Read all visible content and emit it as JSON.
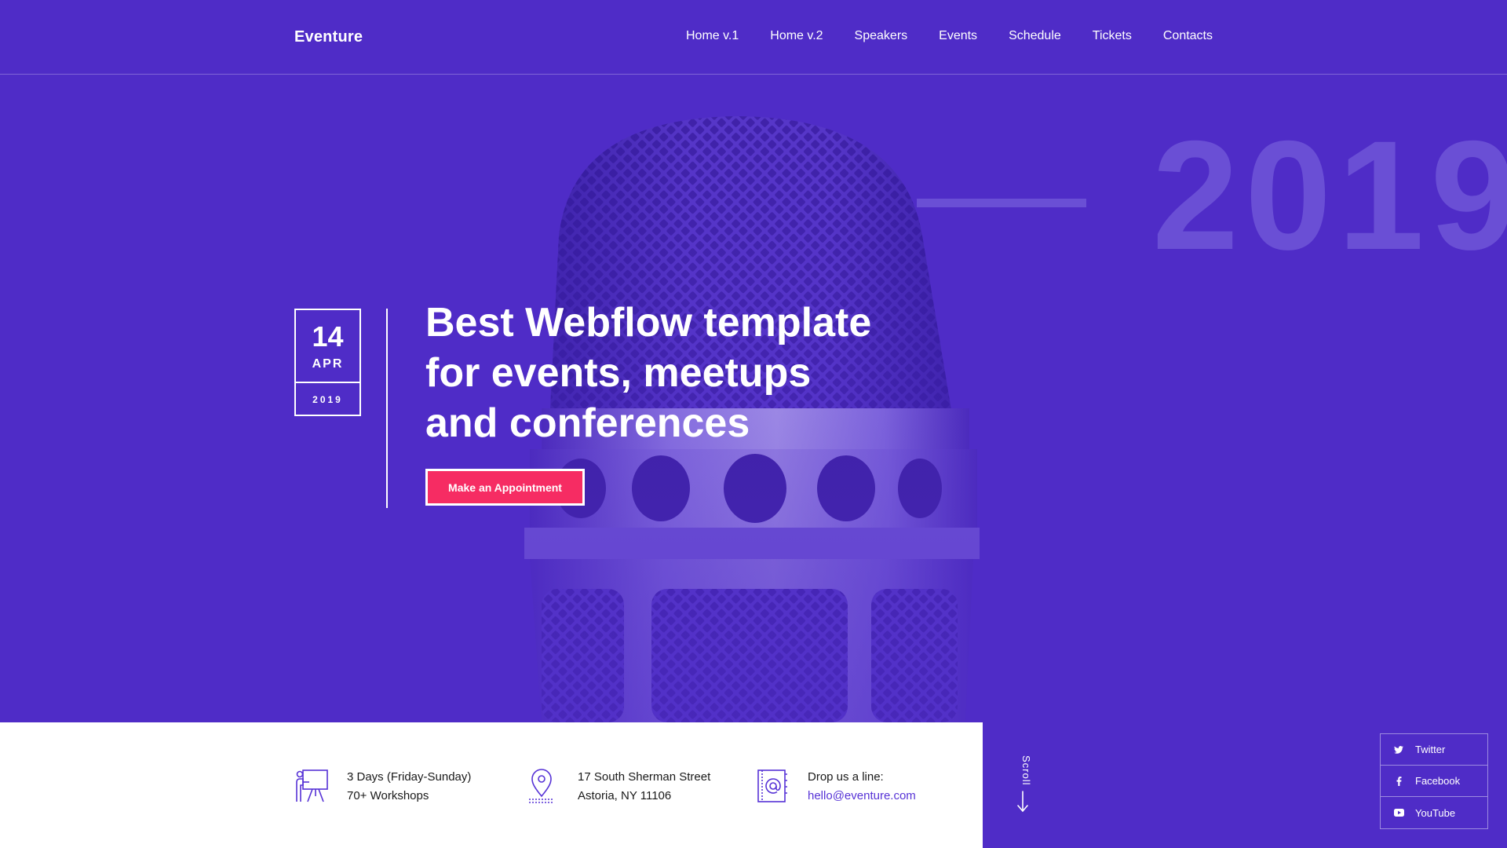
{
  "brand": {
    "name": "Eventure"
  },
  "nav": {
    "items": [
      "Home v.1",
      "Home v.2",
      "Speakers",
      "Events",
      "Schedule",
      "Tickets",
      "Contacts"
    ]
  },
  "hero": {
    "year_watermark": "2019",
    "date": {
      "day": "14",
      "month": "APR",
      "year": "2019"
    },
    "headline_lines": [
      "Best Webflow template",
      "for events, meetups",
      "and conferences"
    ],
    "cta_label": "Make an Appointment"
  },
  "info": {
    "duration": {
      "line1": "3 Days (Friday-Sunday)",
      "line2": "70+ Workshops",
      "icon": "presentation-icon"
    },
    "location": {
      "line1": "17 South Sherman Street",
      "line2": "Astoria, NY 11106",
      "icon": "map-pin-icon"
    },
    "contact": {
      "line1": "Drop us a line:",
      "email": "hello@eventure.com",
      "icon": "address-book-icon"
    }
  },
  "scroll": {
    "label": "Scroll"
  },
  "socials": [
    {
      "label": "Twitter",
      "icon": "twitter-icon"
    },
    {
      "label": "Facebook",
      "icon": "facebook-icon"
    },
    {
      "label": "YouTube",
      "icon": "youtube-icon"
    }
  ],
  "colors": {
    "background": "#4f2cc7",
    "accent": "#f62c63",
    "watermark": "#6a4fd5",
    "link": "#5632d6"
  }
}
